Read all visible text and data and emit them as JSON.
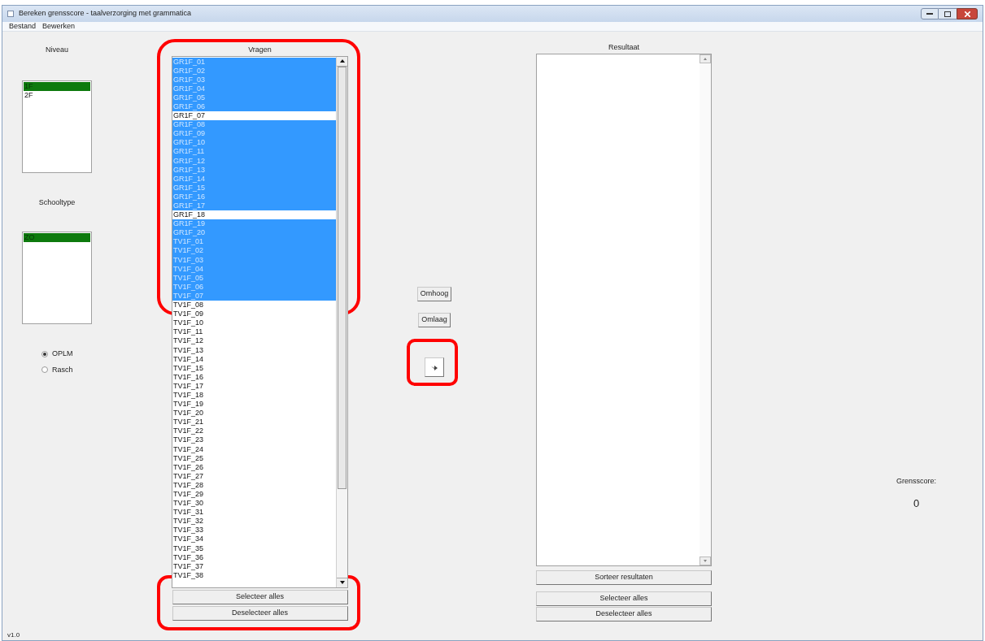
{
  "window": {
    "title": "Bereken grensscore - taalverzorging met grammatica"
  },
  "menu": [
    "Bestand",
    "Bewerken"
  ],
  "niveau": {
    "label": "Niveau",
    "items": [
      {
        "label": "1F",
        "selected": true
      },
      {
        "label": "2F",
        "selected": false
      }
    ]
  },
  "schooltype": {
    "label": "Schooltype",
    "items": [
      {
        "label": "ZO",
        "selected": true
      }
    ]
  },
  "model": [
    {
      "label": "OPLM",
      "selected": true
    },
    {
      "label": "Rasch",
      "selected": false
    }
  ],
  "vragen": {
    "label": "Vragen",
    "items": [
      {
        "label": "GR1F_01",
        "selected": true
      },
      {
        "label": "GR1F_02",
        "selected": true
      },
      {
        "label": "GR1F_03",
        "selected": true
      },
      {
        "label": "GR1F_04",
        "selected": true
      },
      {
        "label": "GR1F_05",
        "selected": true
      },
      {
        "label": "GR1F_06",
        "selected": true
      },
      {
        "label": "GR1F_07",
        "selected": false
      },
      {
        "label": "GR1F_08",
        "selected": true
      },
      {
        "label": "GR1F_09",
        "selected": true
      },
      {
        "label": "GR1F_10",
        "selected": true
      },
      {
        "label": "GR1F_11",
        "selected": true
      },
      {
        "label": "GR1F_12",
        "selected": true
      },
      {
        "label": "GR1F_13",
        "selected": true
      },
      {
        "label": "GR1F_14",
        "selected": true
      },
      {
        "label": "GR1F_15",
        "selected": true
      },
      {
        "label": "GR1F_16",
        "selected": true
      },
      {
        "label": "GR1F_17",
        "selected": true
      },
      {
        "label": "GR1F_18",
        "selected": false
      },
      {
        "label": "GR1F_19",
        "selected": true
      },
      {
        "label": "GR1F_20",
        "selected": true
      },
      {
        "label": "TV1F_01",
        "selected": true
      },
      {
        "label": "TV1F_02",
        "selected": true
      },
      {
        "label": "TV1F_03",
        "selected": true
      },
      {
        "label": "TV1F_04",
        "selected": true
      },
      {
        "label": "TV1F_05",
        "selected": true
      },
      {
        "label": "TV1F_06",
        "selected": true
      },
      {
        "label": "TV1F_07",
        "selected": true
      },
      {
        "label": "TV1F_08",
        "selected": false
      },
      {
        "label": "TV1F_09",
        "selected": false
      },
      {
        "label": "TV1F_10",
        "selected": false
      },
      {
        "label": "TV1F_11",
        "selected": false
      },
      {
        "label": "TV1F_12",
        "selected": false
      },
      {
        "label": "TV1F_13",
        "selected": false
      },
      {
        "label": "TV1F_14",
        "selected": false
      },
      {
        "label": "TV1F_15",
        "selected": false
      },
      {
        "label": "TV1F_16",
        "selected": false
      },
      {
        "label": "TV1F_17",
        "selected": false
      },
      {
        "label": "TV1F_18",
        "selected": false
      },
      {
        "label": "TV1F_19",
        "selected": false
      },
      {
        "label": "TV1F_20",
        "selected": false
      },
      {
        "label": "TV1F_21",
        "selected": false
      },
      {
        "label": "TV1F_22",
        "selected": false
      },
      {
        "label": "TV1F_23",
        "selected": false
      },
      {
        "label": "TV1F_24",
        "selected": false
      },
      {
        "label": "TV1F_25",
        "selected": false
      },
      {
        "label": "TV1F_26",
        "selected": false
      },
      {
        "label": "TV1F_27",
        "selected": false
      },
      {
        "label": "TV1F_28",
        "selected": false
      },
      {
        "label": "TV1F_29",
        "selected": false
      },
      {
        "label": "TV1F_30",
        "selected": false
      },
      {
        "label": "TV1F_31",
        "selected": false
      },
      {
        "label": "TV1F_32",
        "selected": false
      },
      {
        "label": "TV1F_33",
        "selected": false
      },
      {
        "label": "TV1F_34",
        "selected": false
      },
      {
        "label": "TV1F_35",
        "selected": false
      },
      {
        "label": "TV1F_36",
        "selected": false
      },
      {
        "label": "TV1F_37",
        "selected": false
      },
      {
        "label": "TV1F_38",
        "selected": false
      }
    ],
    "buttons": [
      "Selecteer alles",
      "Deselecteer alles"
    ]
  },
  "move_buttons": [
    "Omhoog",
    "Omlaag"
  ],
  "resultaat": {
    "label": "Resultaat",
    "buttons": [
      "Sorteer resultaten",
      "Selecteer alles",
      "Deselecteer alles"
    ]
  },
  "grensscore": {
    "label": "Grensscore:",
    "value": "0"
  },
  "version": "v1.0"
}
